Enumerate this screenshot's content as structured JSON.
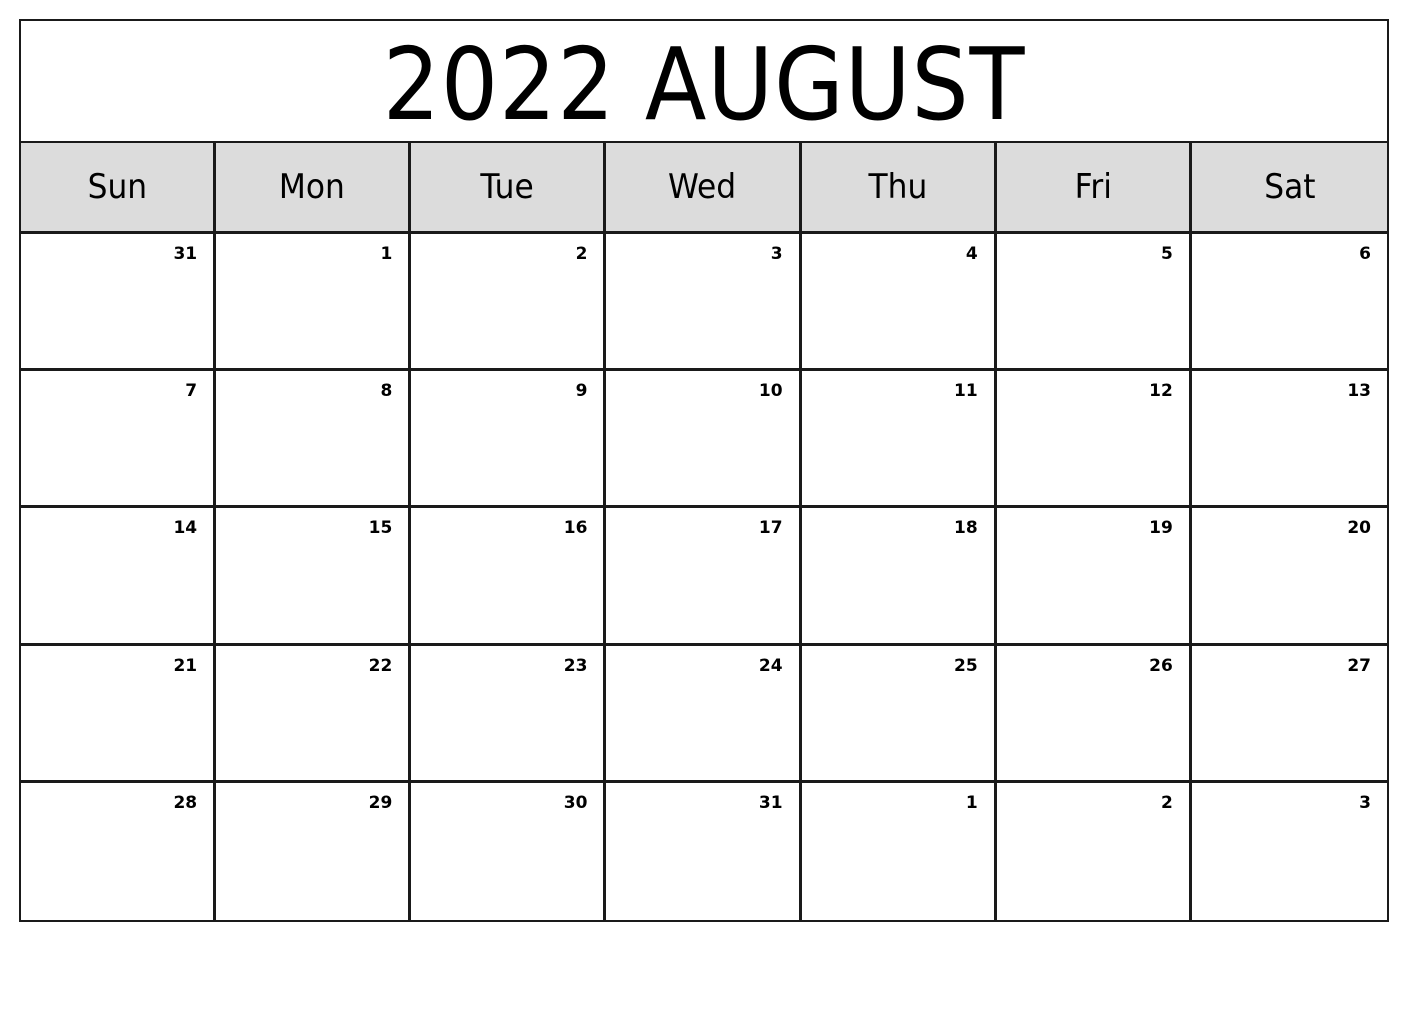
{
  "calendar": {
    "title": "2022 AUGUST",
    "year": 2022,
    "month": "AUGUST",
    "weekdays": [
      "Sun",
      "Mon",
      "Tue",
      "Wed",
      "Thu",
      "Fri",
      "Sat"
    ],
    "weeks": [
      [
        "31",
        "1",
        "2",
        "3",
        "4",
        "5",
        "6"
      ],
      [
        "7",
        "8",
        "9",
        "10",
        "11",
        "12",
        "13"
      ],
      [
        "14",
        "15",
        "16",
        "17",
        "18",
        "19",
        "20"
      ],
      [
        "21",
        "22",
        "23",
        "24",
        "25",
        "26",
        "27"
      ],
      [
        "28",
        "29",
        "30",
        "31",
        "1",
        "2",
        "3"
      ]
    ],
    "colors": {
      "header_bg": "#dcdcdc",
      "border": "#1a1a1a",
      "text": "#000000"
    }
  }
}
